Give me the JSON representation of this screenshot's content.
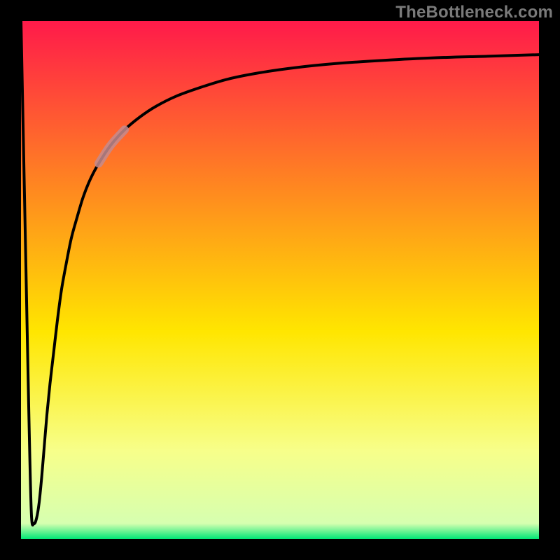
{
  "watermark": "TheBottleneck.com",
  "colors": {
    "frame": "#000000",
    "curve": "#000000",
    "highlight": "#c48b8e",
    "gradient_top": "#ff1a4a",
    "gradient_mid_upper": "#ff8a1f",
    "gradient_mid": "#ffe600",
    "gradient_mid_lower": "#f7ff8a",
    "gradient_bottom": "#00e676"
  },
  "chart_data": {
    "type": "line",
    "title": "",
    "xlabel": "",
    "ylabel": "",
    "xlim": [
      0,
      100
    ],
    "ylim": [
      0,
      100
    ],
    "grid": false,
    "legend": false,
    "annotations": [],
    "series": [
      {
        "name": "bottleneck-curve",
        "x": [
          0.0,
          0.5,
          1.0,
          1.5,
          2.0,
          2.5,
          3.0,
          3.5,
          4.0,
          4.5,
          5.0,
          5.6,
          6.3,
          7.0,
          7.8,
          8.7,
          9.7,
          10.8,
          12.0,
          13.4,
          15.0,
          17.3,
          20,
          23,
          26,
          30,
          35,
          40,
          46,
          53,
          61,
          70,
          80,
          90,
          100
        ],
        "y": [
          100,
          75,
          50,
          25,
          5,
          3,
          4,
          7,
          12,
          18,
          24,
          30,
          36,
          42,
          48,
          53,
          58,
          62,
          66,
          69.5,
          72.5,
          76,
          79,
          81.5,
          83.5,
          85.5,
          87.3,
          88.8,
          90.0,
          91.0,
          91.8,
          92.4,
          92.9,
          93.2,
          93.5
        ]
      }
    ],
    "highlight_segment": {
      "series": "bottleneck-curve",
      "x_start": 15.0,
      "x_end": 20.0
    },
    "background_gradient": {
      "direction": "vertical",
      "stops": [
        {
          "pos": 0.0,
          "color": "#ff1a4a"
        },
        {
          "pos": 0.33,
          "color": "#ff8a1f"
        },
        {
          "pos": 0.6,
          "color": "#ffe600"
        },
        {
          "pos": 0.83,
          "color": "#f7ff8a"
        },
        {
          "pos": 0.97,
          "color": "#d6ffb0"
        },
        {
          "pos": 1.0,
          "color": "#00e676"
        }
      ]
    }
  }
}
